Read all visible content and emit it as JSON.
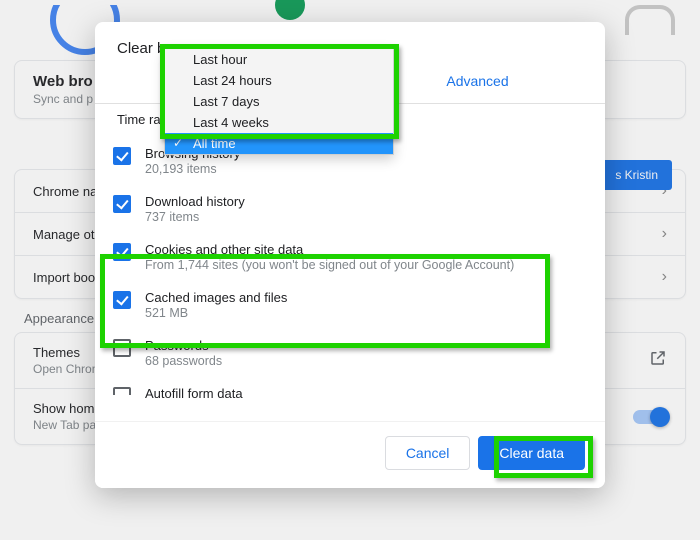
{
  "bg": {
    "webBrowser": {
      "title": "Web bro",
      "sub": "Sync and p"
    },
    "continueAs": "s Kristin",
    "rows": {
      "chromeName": "Chrome na",
      "manageOther": "Manage otl",
      "importBook": "Import boo"
    },
    "appearance": {
      "header": "Appearance",
      "themes": "Themes",
      "themesSub": "Open Chrom",
      "homeBtn": "Show home button",
      "homeSub": "New Tab page"
    }
  },
  "modal": {
    "title": "Clear b",
    "tabs": {
      "advanced": "Advanced"
    },
    "timeRangeLabel": "Time rar",
    "options": {
      "lastHour": "Last hour",
      "last24": "Last 24 hours",
      "last7": "Last 7 days",
      "last4w": "Last 4 weeks",
      "allTime": "All time"
    },
    "items": {
      "browsing": {
        "label": "Browsing history",
        "sub": "20,193 items"
      },
      "download": {
        "label": "Download history",
        "sub": "737 items"
      },
      "cookies": {
        "label": "Cookies and other site data",
        "sub": "From 1,744 sites (you won't be signed out of your Google Account)"
      },
      "cached": {
        "label": "Cached images and files",
        "sub": "521 MB"
      },
      "passwords": {
        "label": "Passwords",
        "sub": "68 passwords"
      },
      "autofill": {
        "label": "Autofill form data"
      }
    },
    "cancel": "Cancel",
    "clear": "Clear data"
  }
}
